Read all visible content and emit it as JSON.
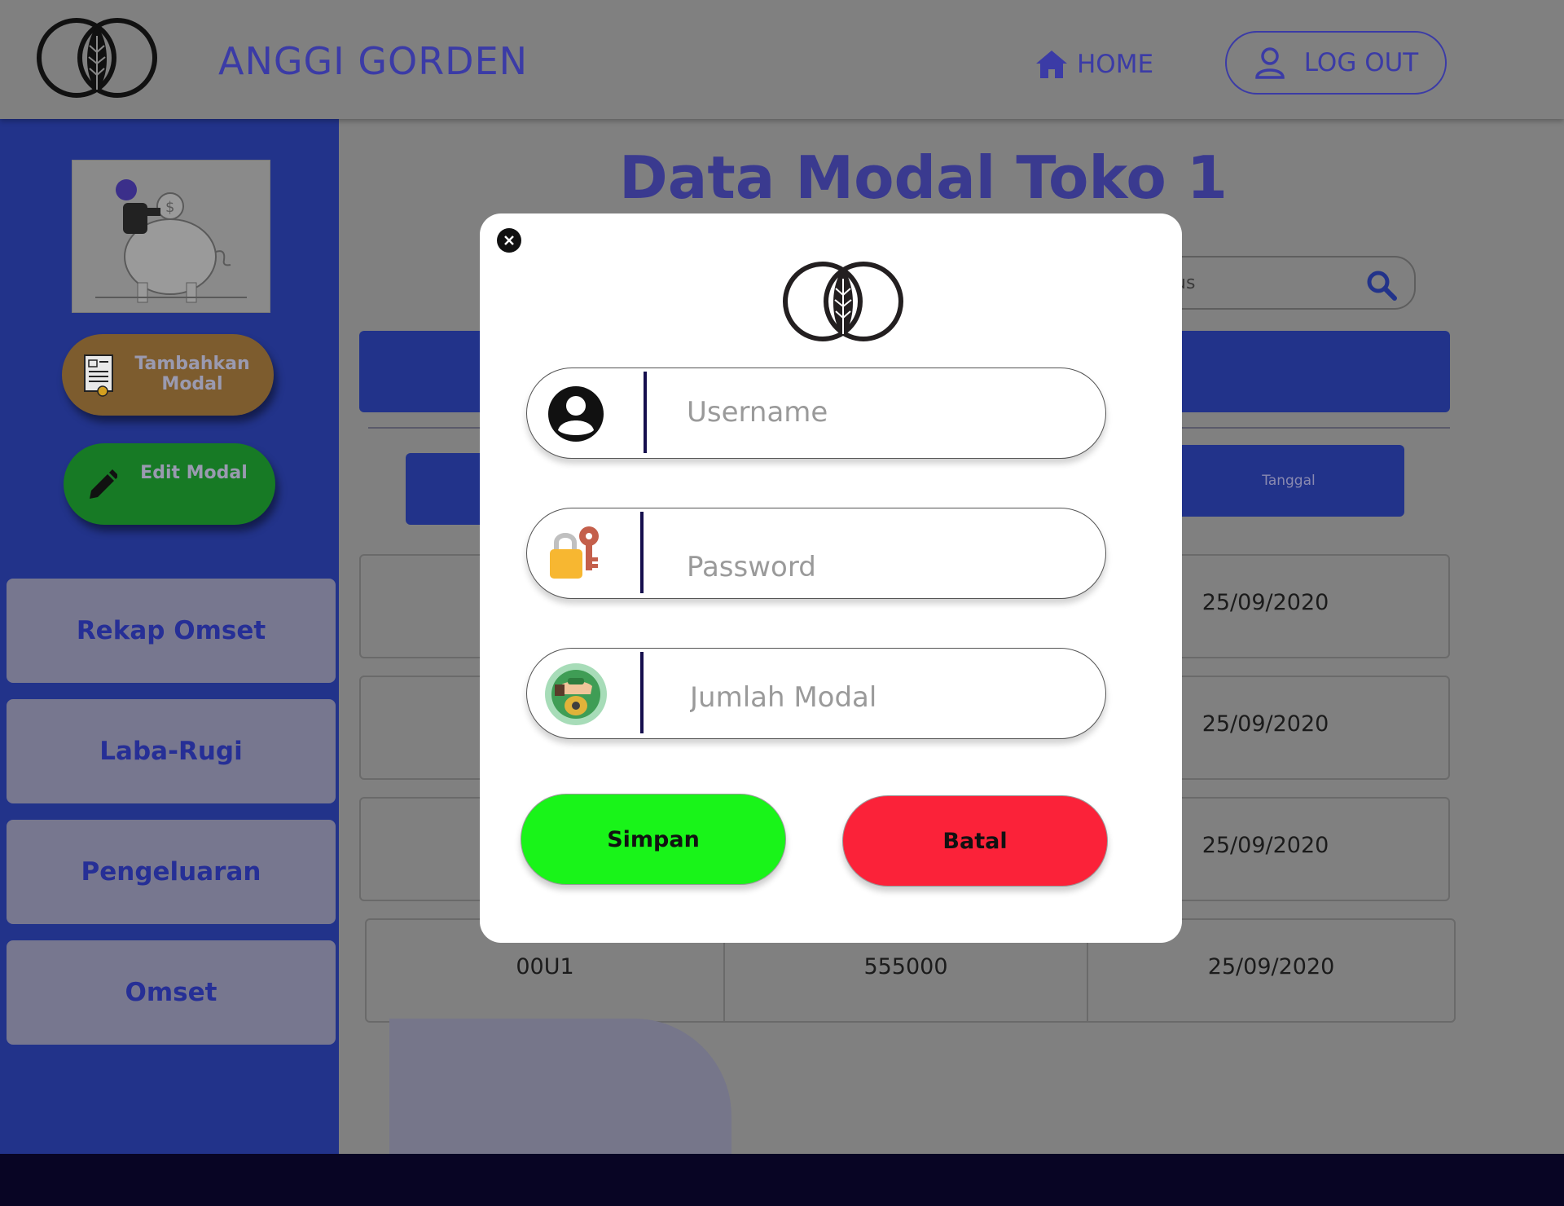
{
  "header": {
    "brand": "ANGGI GORDEN",
    "home_label": "HOME",
    "logout_label": "LOG OUT"
  },
  "sidebar": {
    "tambah_label": "Tambahkan Modal",
    "edit_label": "Edit Modal",
    "nav": [
      "Rekap Omset",
      "Laba-Rugi",
      "Pengeluaran",
      "Omset"
    ]
  },
  "main": {
    "title": "Data Modal Toko 1",
    "search_partial": "us",
    "column_header_visible": "Tanggal",
    "rows": [
      {
        "c1": "",
        "c2": "",
        "c3": "25/09/2020"
      },
      {
        "c1": "",
        "c2": "",
        "c3": "25/09/2020"
      },
      {
        "c1": "",
        "c2": "",
        "c3": "25/09/2020"
      },
      {
        "c1": "00U1",
        "c2": "555000",
        "c3": "25/09/2020"
      }
    ]
  },
  "modal": {
    "username_placeholder": "Username",
    "password_placeholder": "Password",
    "jumlah_placeholder": "Jumlah Modal",
    "simpan_label": "Simpan",
    "batal_label": "Batal"
  },
  "colors": {
    "sidebar": "#22338a",
    "simpan": "#19f419",
    "batal": "#fb2239",
    "footer": "#080524"
  }
}
